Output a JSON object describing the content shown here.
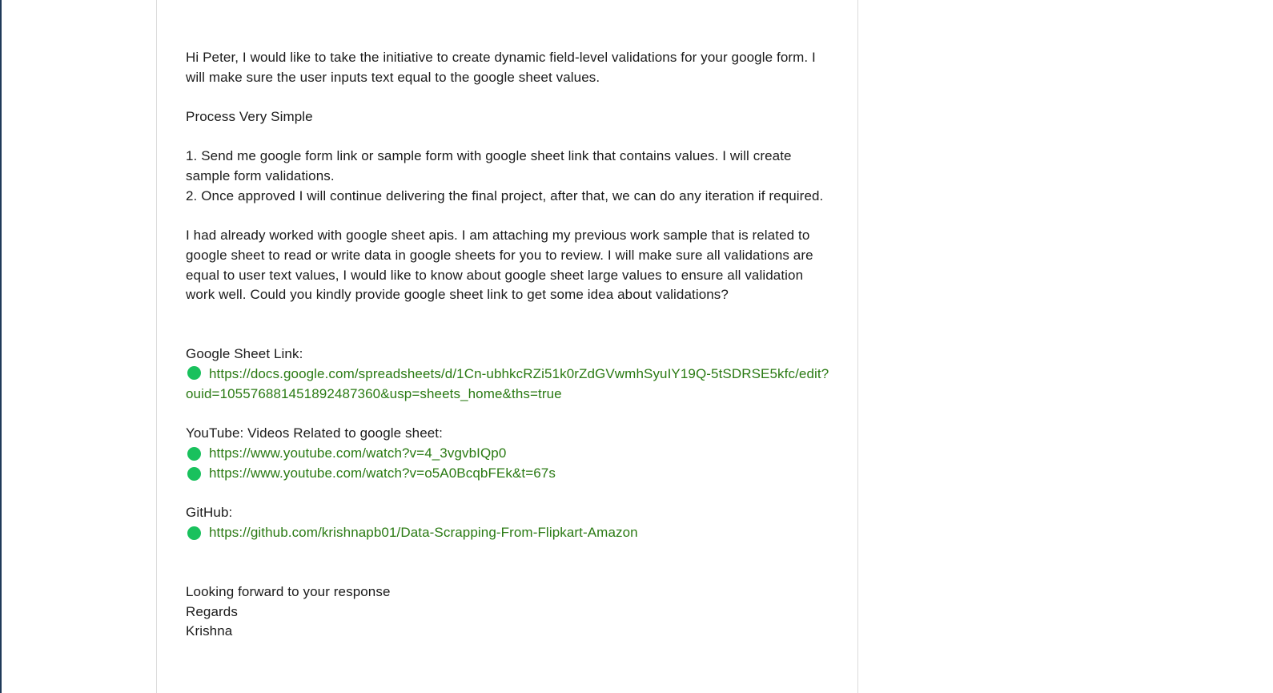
{
  "proposal": {
    "intro": "Hi Peter, I would like to take the initiative to create dynamic field-level validations for your google form. I will make sure the user inputs text equal to the google sheet values.",
    "process_heading": "Process Very Simple",
    "steps": [
      "1. Send me google form link or sample form with google sheet link that contains values. I will create sample form validations.",
      "2. Once approved I will continue delivering the final project, after that, we can do any iteration if required."
    ],
    "experience": "I had already worked with google sheet apis. I am attaching my previous work sample that is related to google sheet to read or write data in google sheets for you to review. I will make sure all validations are equal to user text values, I would like to know about google sheet large values to ensure all validation work well. Could you kindly provide google sheet link to get some idea about validations?",
    "sheet_label": "Google Sheet Link:",
    "sheet_link": "https://docs.google.com/spreadsheets/d/1Cn-ubhkcRZi51k0rZdGVwmhSyuIY19Q-5tSDRSE5kfc/edit?ouid=105576881451892487360&usp=sheets_home&ths=true",
    "youtube_label": "YouTube: Videos Related to google sheet:",
    "youtube_links": [
      "https://www.youtube.com/watch?v=4_3vgvbIQp0",
      "https://www.youtube.com/watch?v=o5A0BcqbFEk&t=67s"
    ],
    "github_label": "GitHub:",
    "github_link": "https://github.com/krishnapb01/Data-Scrapping-From-Flipkart-Amazon",
    "closing": "Looking forward to your response",
    "regards": "Regards",
    "signature": "Krishna"
  },
  "colors": {
    "link": "#2a7a13",
    "bullet": "#19c15d",
    "text": "#1b1b1b"
  }
}
